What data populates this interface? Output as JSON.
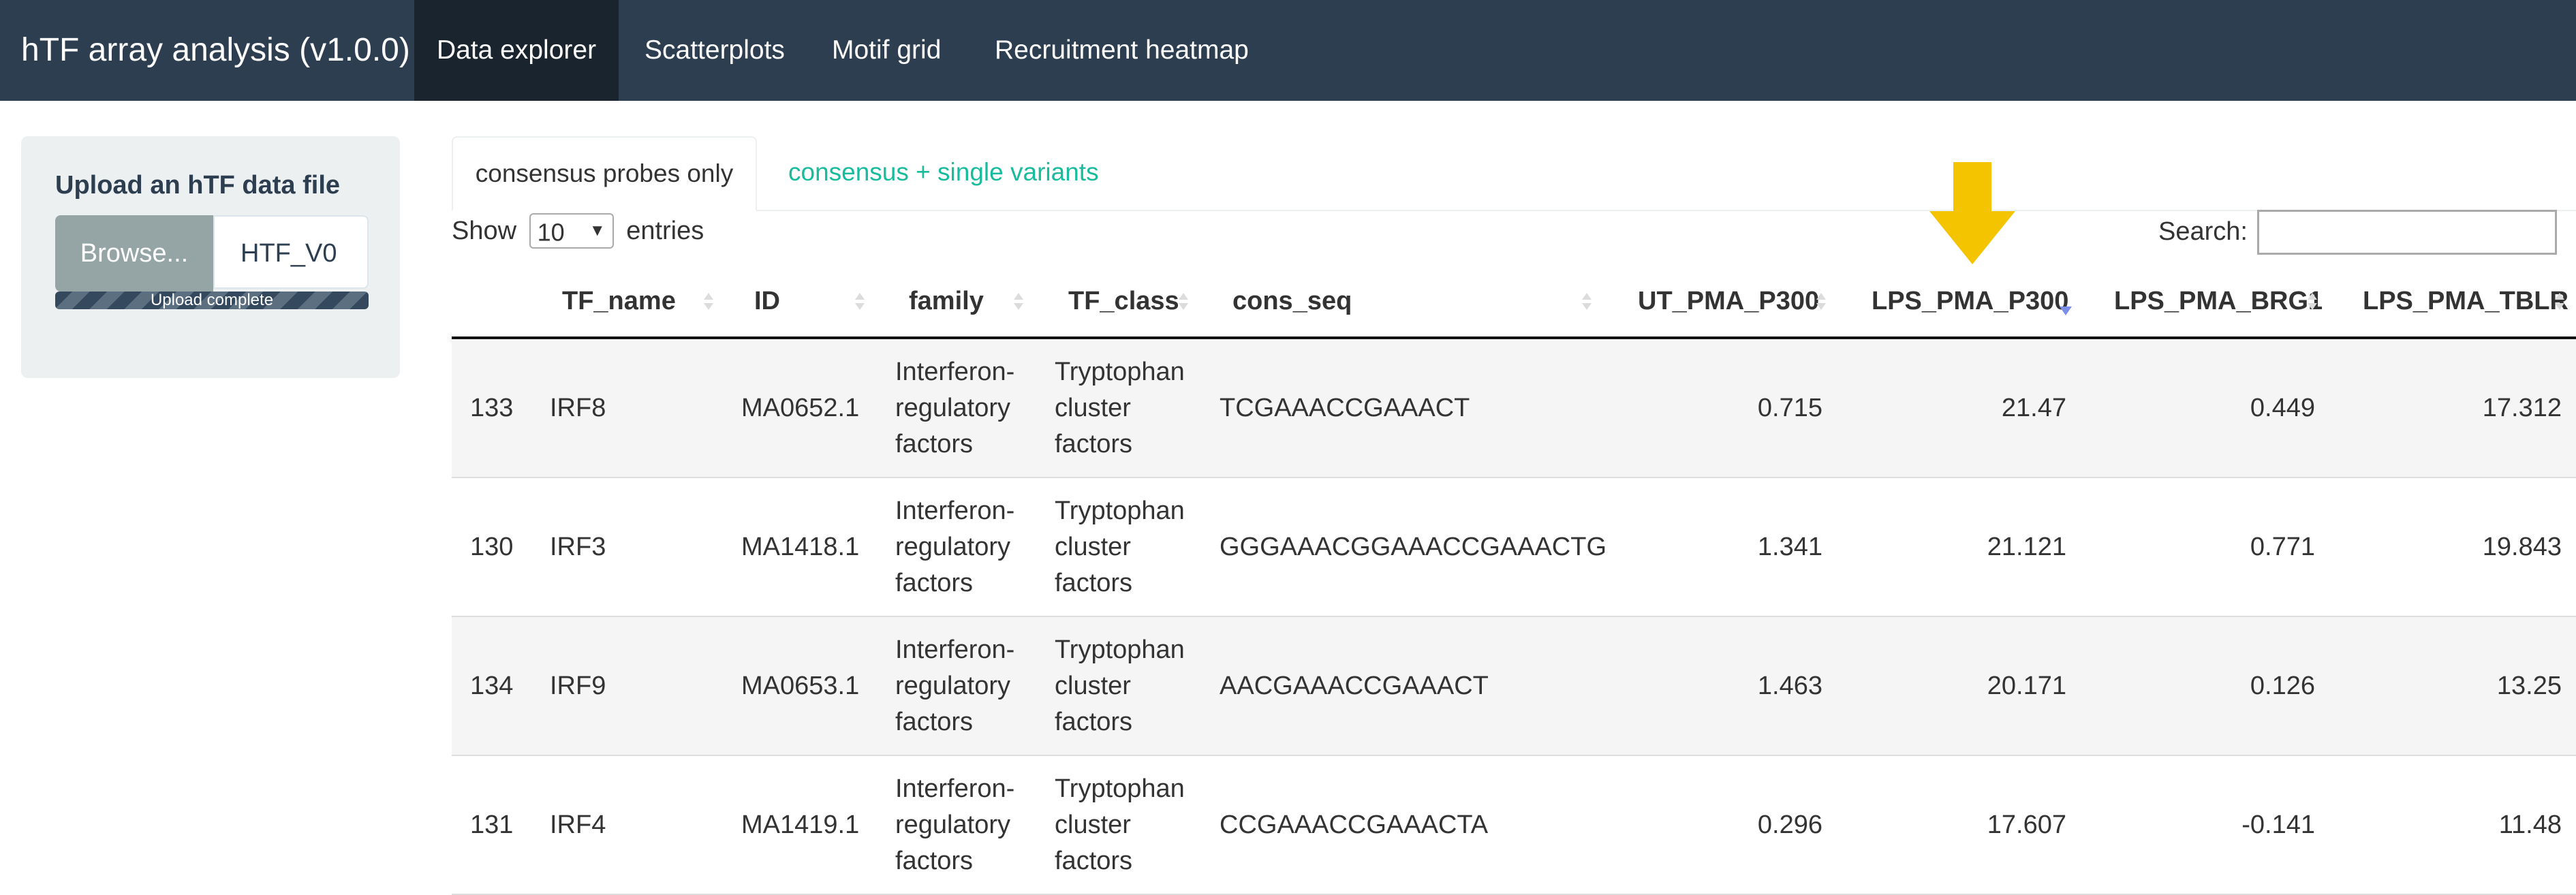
{
  "navbar": {
    "brand": "hTF array analysis (v1.0.0)",
    "items": [
      {
        "label": "Data explorer",
        "active": true
      },
      {
        "label": "Scatterplots",
        "active": false
      },
      {
        "label": "Motif grid",
        "active": false
      },
      {
        "label": "Recruitment heatmap",
        "active": false
      }
    ]
  },
  "sidebar": {
    "upload_label": "Upload an hTF data file",
    "browse_label": "Browse...",
    "file_name": "HTF_V0",
    "progress_text": "Upload complete",
    "progress_fraction": 1.0
  },
  "tabs": [
    {
      "label": "consensus probes only",
      "active": true
    },
    {
      "label": "consensus + single variants",
      "active": false
    }
  ],
  "controls": {
    "show_label": "Show",
    "entries_value": "10",
    "entries_label": "entries",
    "search_label": "Search:",
    "search_value": ""
  },
  "table": {
    "columns": [
      {
        "label": "",
        "sortable": false
      },
      {
        "label": "TF_name",
        "sortable": true
      },
      {
        "label": "ID",
        "sortable": true
      },
      {
        "label": "family",
        "sortable": true
      },
      {
        "label": "TF_class",
        "sortable": true
      },
      {
        "label": "cons_seq",
        "sortable": true
      },
      {
        "label": "UT_PMA_P300",
        "sortable": true
      },
      {
        "label": "LPS_PMA_P300",
        "sortable": true,
        "sorted": "desc"
      },
      {
        "label": "LPS_PMA_BRG1",
        "sortable": true
      },
      {
        "label": "LPS_PMA_TBLR",
        "sortable": true
      }
    ],
    "rows": [
      [
        "133",
        "IRF8",
        "MA0652.1",
        "Interferon-regulatory factors",
        "Tryptophan cluster factors",
        "TCGAAACCGAAACT",
        "0.715",
        "21.47",
        "0.449",
        "17.312"
      ],
      [
        "130",
        "IRF3",
        "MA1418.1",
        "Interferon-regulatory factors",
        "Tryptophan cluster factors",
        "GGGAAACGGAAACCGAAACTG",
        "1.341",
        "21.121",
        "0.771",
        "19.843"
      ],
      [
        "134",
        "IRF9",
        "MA0653.1",
        "Interferon-regulatory factors",
        "Tryptophan cluster factors",
        "AACGAAACCGAAACT",
        "1.463",
        "20.171",
        "0.126",
        "13.25"
      ],
      [
        "131",
        "IRF4",
        "MA1419.1",
        "Interferon-regulatory factors",
        "Tryptophan cluster factors",
        "CCGAAACCGAAACTA",
        "0.296",
        "17.607",
        "-0.141",
        "11.48"
      ]
    ]
  },
  "colors": {
    "navbar_bg": "#2c3e50",
    "navbar_active_bg": "#1a242f",
    "accent_link": "#18bc9c",
    "annotation_arrow": "#f5c400"
  }
}
